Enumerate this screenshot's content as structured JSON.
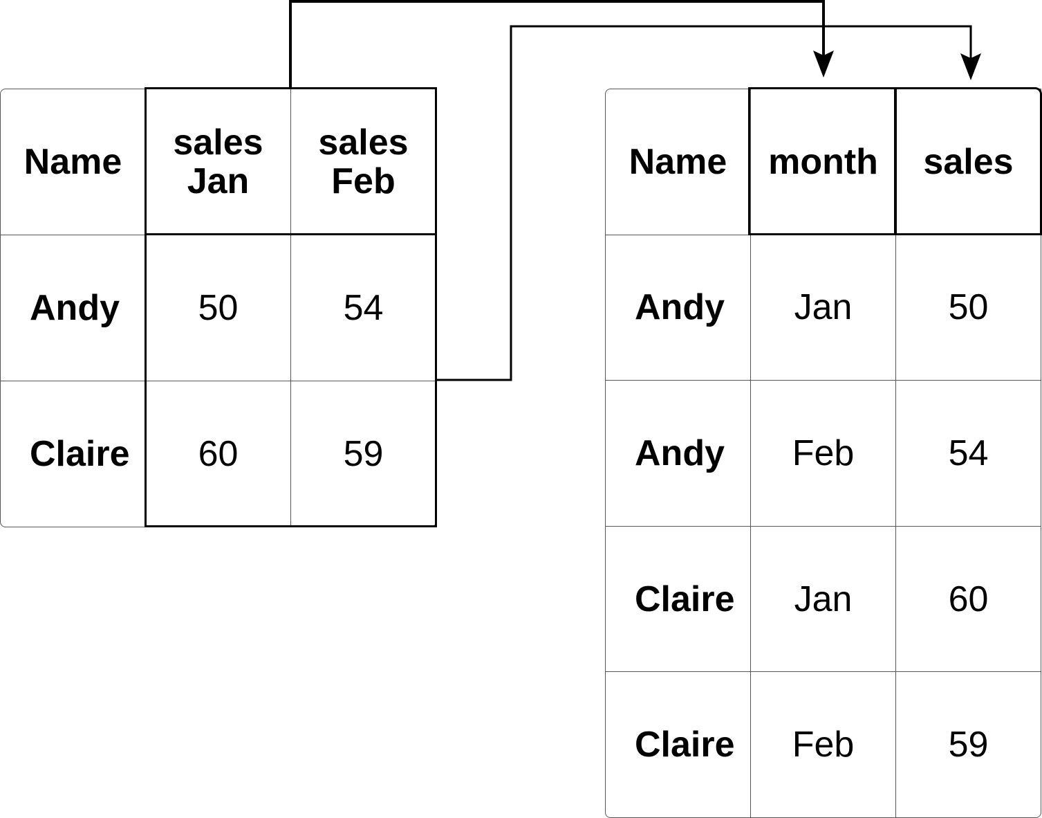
{
  "wide_table": {
    "headers": [
      "Name",
      "sales\nJan",
      "sales\nFeb"
    ],
    "rows": [
      [
        "Andy",
        "50",
        "54"
      ],
      [
        "Claire",
        "60",
        "59"
      ]
    ]
  },
  "long_table": {
    "headers": [
      "Name",
      "month",
      "sales"
    ],
    "rows": [
      [
        "Andy",
        "Jan",
        "50"
      ],
      [
        "Andy",
        "Feb",
        "54"
      ],
      [
        "Claire",
        "Jan",
        "60"
      ],
      [
        "Claire",
        "Feb",
        "59"
      ]
    ]
  }
}
